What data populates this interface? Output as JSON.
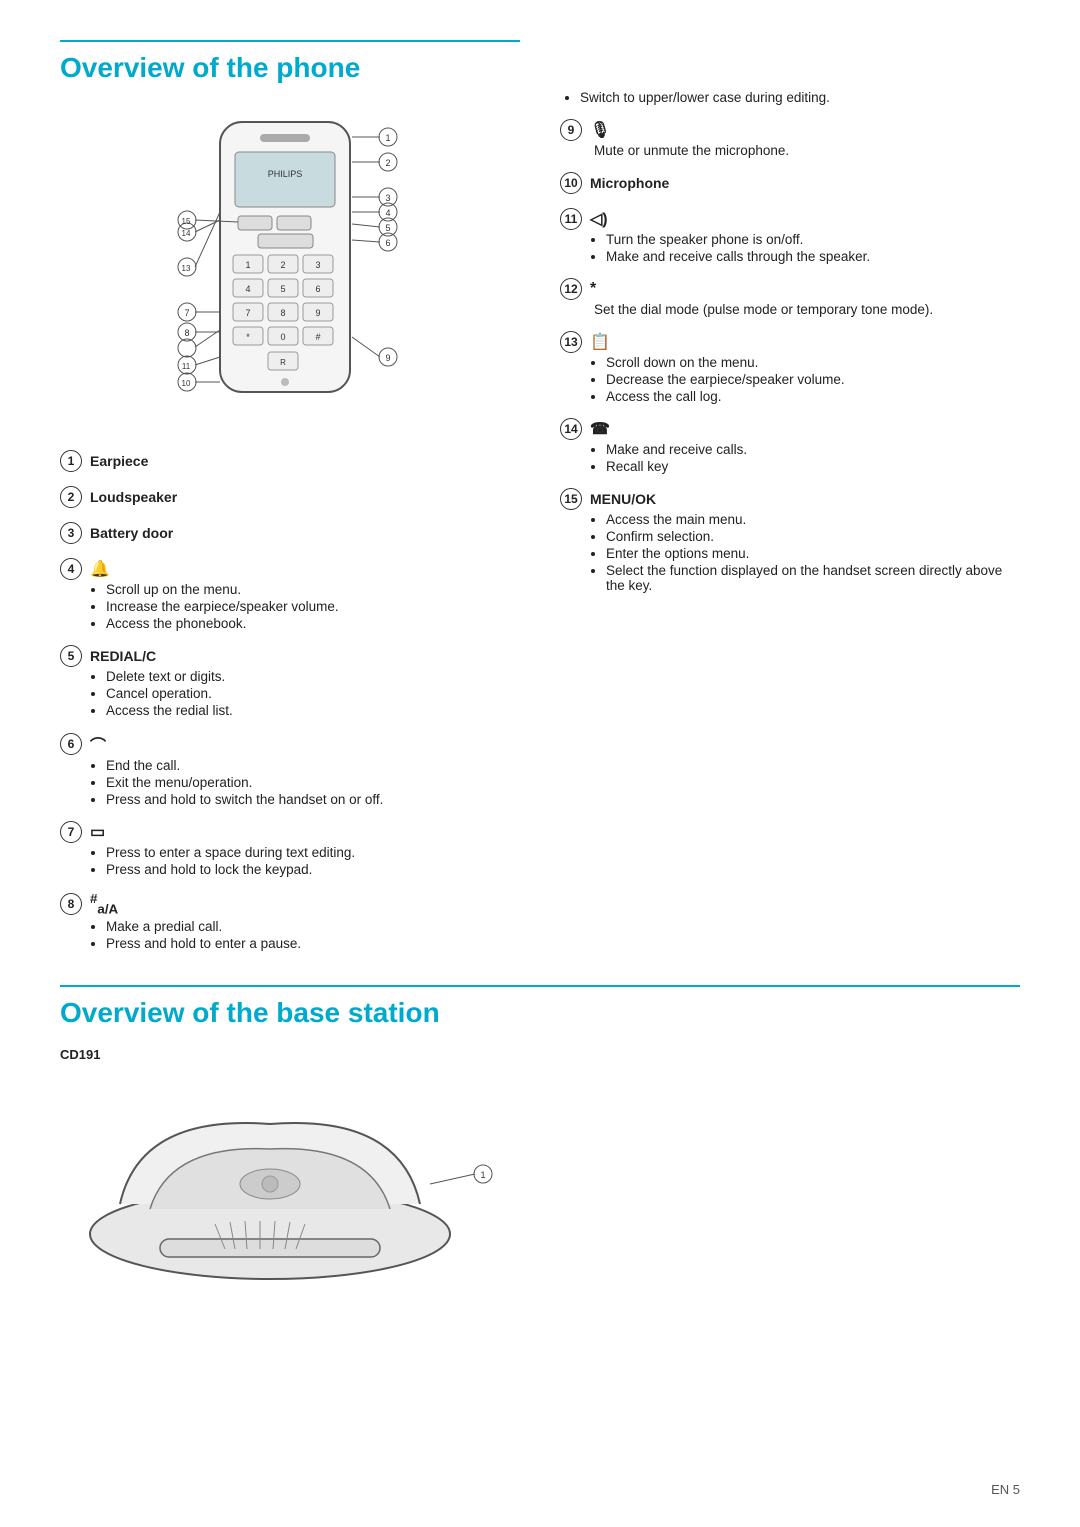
{
  "page": {
    "title": "Overview of the phone",
    "base_title": "Overview of the base station",
    "base_model": "CD191",
    "page_number": "EN   5"
  },
  "items": [
    {
      "num": "1",
      "label": "Earpiece",
      "icon": "",
      "bullets": []
    },
    {
      "num": "2",
      "label": "Loudspeaker",
      "icon": "",
      "bullets": []
    },
    {
      "num": "3",
      "label": "Battery door",
      "icon": "",
      "bullets": []
    },
    {
      "num": "4",
      "label": "🔔",
      "icon": "🔔",
      "bullets": [
        "Scroll up on the menu.",
        "Increase the earpiece/speaker volume.",
        "Access the phonebook."
      ]
    },
    {
      "num": "5",
      "label": "REDIAL/C",
      "icon": "",
      "bullets": [
        "Delete text or digits.",
        "Cancel operation.",
        "Access the redial list."
      ]
    },
    {
      "num": "6",
      "label": "↗",
      "icon": "↗",
      "bullets": [
        "End the call.",
        "Exit the menu/operation.",
        "Press and hold to switch the handset on or off."
      ]
    },
    {
      "num": "7",
      "label": "☐",
      "icon": "☐",
      "bullets": [
        "Press to enter a space during text editing.",
        "Press and hold to lock the keypad."
      ]
    },
    {
      "num": "8",
      "label": "#/A",
      "icon": "#/A",
      "bullets": [
        "Make a predial call.",
        "Press and hold to enter a pause."
      ]
    }
  ],
  "right_items": [
    {
      "pre_bullets": [
        "Switch to upper/lower case during editing."
      ]
    },
    {
      "num": "9",
      "label": "🎤",
      "icon": "🎤",
      "description": "Mute or unmute the microphone.",
      "bullets": []
    },
    {
      "num": "10",
      "label": "Microphone",
      "icon": "",
      "bullets": []
    },
    {
      "num": "11",
      "label": "◁)",
      "icon": "◁)",
      "bullets": [
        "Turn the speaker phone is on/off.",
        "Make and receive calls through the speaker."
      ]
    },
    {
      "num": "12",
      "label": "*",
      "icon": "*",
      "description": "Set the dial mode (pulse mode or temporary tone mode).",
      "bullets": []
    },
    {
      "num": "13",
      "label": "📞",
      "icon": "📞",
      "bullets": [
        "Scroll down on the menu.",
        "Decrease the earpiece/speaker volume.",
        "Access the call log."
      ]
    },
    {
      "num": "14",
      "label": "📲",
      "icon": "📲",
      "bullets": [
        "Make and receive calls.",
        "Recall key"
      ]
    },
    {
      "num": "15",
      "label": "MENU/OK",
      "icon": "",
      "bullets": [
        "Access the main menu.",
        "Confirm selection.",
        "Enter the options menu.",
        "Select the function displayed on the handset screen directly above the key."
      ]
    }
  ]
}
